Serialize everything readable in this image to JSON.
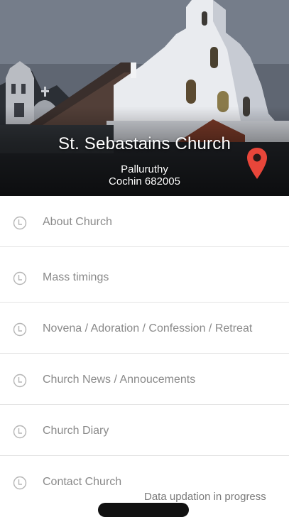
{
  "header": {
    "title": "St. Sebastains Church",
    "address_line1": "Palluruthy",
    "address_line2": "Cochin 682005",
    "pin_color": "#e8463a"
  },
  "menu": {
    "items": [
      {
        "label": "About Church",
        "icon": "clock-icon"
      },
      {
        "label": "Mass timings",
        "icon": "clock-icon"
      },
      {
        "label": "Novena / Adoration / Confession / Retreat",
        "icon": "clock-icon"
      },
      {
        "label": "Church News / Annoucements",
        "icon": "clock-icon"
      },
      {
        "label": "Church Diary",
        "icon": "clock-icon"
      },
      {
        "label": "Contact Church",
        "icon": "clock-icon"
      }
    ]
  },
  "status": {
    "message": "Data updation in progress"
  }
}
